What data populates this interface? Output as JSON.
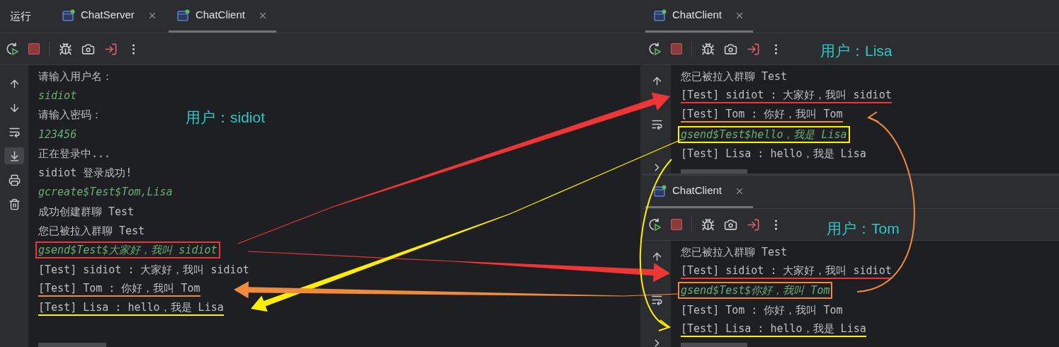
{
  "panels": [
    {
      "run_label": "运行",
      "user_label": "用户：sidiot",
      "tabs": [
        {
          "label": "ChatServer",
          "selected": false
        },
        {
          "label": "ChatClient",
          "selected": true
        }
      ],
      "gutter": [
        {
          "kind": "up",
          "selected": false
        },
        {
          "kind": "down",
          "selected": false
        },
        {
          "kind": "wrap",
          "selected": false
        },
        {
          "kind": "scroll_end",
          "selected": true
        },
        {
          "kind": "print",
          "selected": false
        },
        {
          "kind": "trash",
          "selected": false
        }
      ],
      "lines": [
        {
          "kind": "output",
          "text": "请输入用户名：",
          "boxed": false,
          "underlined": false
        },
        {
          "kind": "input",
          "text": "sidiot",
          "boxed": false,
          "underlined": false
        },
        {
          "kind": "output",
          "text": "请输入密码：",
          "boxed": false,
          "underlined": false
        },
        {
          "kind": "input",
          "text": "123456",
          "boxed": false,
          "underlined": false
        },
        {
          "kind": "output",
          "text": "正在登录中...",
          "boxed": false,
          "underlined": false
        },
        {
          "kind": "output",
          "text": "sidiot 登录成功!",
          "boxed": false,
          "underlined": false
        },
        {
          "kind": "input",
          "text": "gcreate$Test$Tom,Lisa",
          "boxed": false,
          "underlined": false
        },
        {
          "kind": "output",
          "text": "成功创建群聊 Test",
          "boxed": false,
          "underlined": false
        },
        {
          "kind": "output",
          "text": "您已被拉入群聊 Test",
          "boxed": false,
          "underlined": false
        },
        {
          "kind": "input",
          "text": "gsend$Test$大家好，我叫 sidiot",
          "boxed": true,
          "underlined": false,
          "color": "#e8383d"
        },
        {
          "kind": "output",
          "text": "[Test] sidiot : 大家好，我叫 sidiot",
          "boxed": false,
          "underlined": false
        },
        {
          "kind": "output",
          "text": "[Test] Tom : 你好，我叫 Tom",
          "boxed": false,
          "underlined": true,
          "color": "#f0883a"
        },
        {
          "kind": "output",
          "text": "[Test] Lisa : hello，我是 Lisa",
          "boxed": false,
          "underlined": true,
          "color": "#fff200"
        }
      ]
    },
    {
      "user_label": "用户：Lisa",
      "tabs": [
        {
          "label": "ChatClient",
          "selected": true
        }
      ],
      "gutter": [
        {
          "kind": "up",
          "selected": false
        },
        {
          "kind": "wrap",
          "selected": false
        },
        {
          "kind": "more",
          "selected": false
        }
      ],
      "lines": [
        {
          "kind": "output",
          "text": "您已被拉入群聊 Test",
          "boxed": false,
          "underlined": false
        },
        {
          "kind": "output",
          "text": "[Test] sidiot : 大家好，我叫 sidiot",
          "boxed": false,
          "underlined": true,
          "color": "#e8383d"
        },
        {
          "kind": "output",
          "text": "[Test] Tom : 你好，我叫 Tom",
          "boxed": false,
          "underlined": true,
          "color": "#f0883a"
        },
        {
          "kind": "input",
          "text": "gsend$Test$hello，我是 Lisa",
          "boxed": true,
          "underlined": false,
          "color": "#fff200"
        },
        {
          "kind": "output",
          "text": "[Test] Lisa : hello，我是 Lisa",
          "boxed": false,
          "underlined": false
        }
      ]
    },
    {
      "user_label": "用户：Tom",
      "tabs": [
        {
          "label": "ChatClient",
          "selected": true
        }
      ],
      "gutter": [
        {
          "kind": "up",
          "selected": false
        },
        {
          "kind": "wrap",
          "selected": false
        },
        {
          "kind": "more",
          "selected": false
        }
      ],
      "lines": [
        {
          "kind": "output",
          "text": "您已被拉入群聊 Test",
          "boxed": false,
          "underlined": false
        },
        {
          "kind": "output",
          "text": "[Test] sidiot : 大家好，我叫 sidiot",
          "boxed": false,
          "underlined": true,
          "color": "#e8383d"
        },
        {
          "kind": "input",
          "text": "gsend$Test$你好，我叫 Tom",
          "boxed": true,
          "underlined": false,
          "color": "#f0883a"
        },
        {
          "kind": "output",
          "text": "[Test] Tom : 你好，我叫 Tom",
          "boxed": false,
          "underlined": false
        },
        {
          "kind": "output",
          "text": "[Test] Lisa : hello，我是 Lisa",
          "boxed": false,
          "underlined": true,
          "color": "#fff200"
        }
      ]
    }
  ]
}
